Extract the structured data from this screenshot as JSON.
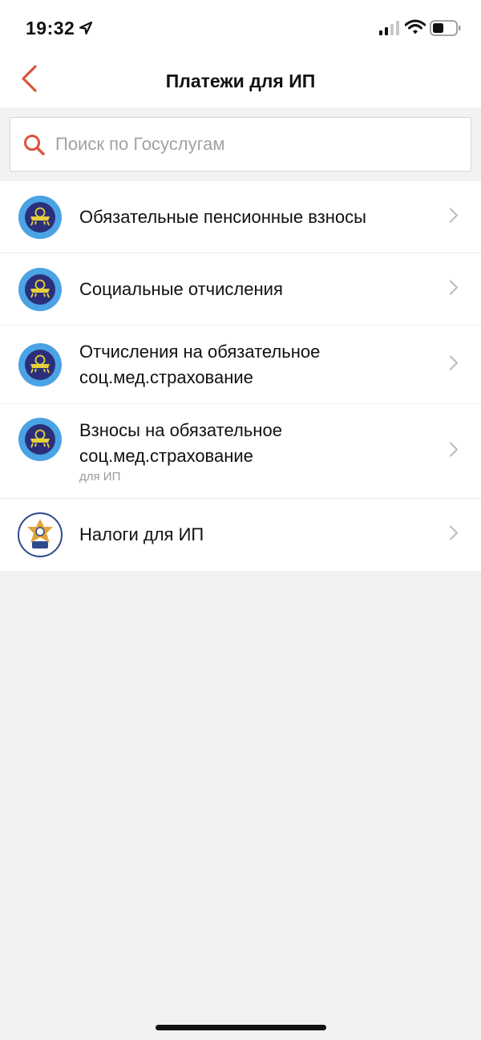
{
  "status_bar": {
    "time": "19:32",
    "icons": [
      "location-arrow-icon",
      "signal-icon",
      "wifi-icon",
      "battery-icon"
    ]
  },
  "nav": {
    "title": "Платежи для ИП",
    "back_icon": "chevron-left-icon"
  },
  "search": {
    "placeholder": "Поиск по Госуслугам",
    "value": ""
  },
  "items": [
    {
      "title_lines": [
        "Обязательные пенсионные взносы"
      ],
      "subtitle": "",
      "icon": "agency-emblem-icon"
    },
    {
      "title_lines": [
        "Социальные отчисления"
      ],
      "subtitle": "",
      "icon": "agency-emblem-icon"
    },
    {
      "title_lines": [
        "Отчисления на обязательное",
        "соц.мед.страхование"
      ],
      "subtitle": "",
      "icon": "agency-emblem-icon"
    },
    {
      "title_lines": [
        "Взносы на обязательное",
        "соц.мед.страхование"
      ],
      "subtitle": "для ИП",
      "icon": "agency-emblem-icon"
    },
    {
      "title_lines": [
        "Налоги для ИП"
      ],
      "subtitle": "",
      "icon": "tax-emblem-icon"
    }
  ],
  "colors": {
    "accent": "#d9553b",
    "background": "#f2f2f2",
    "emblem_outer": "#4aa3e4",
    "emblem_inner": "#2b2f7a",
    "emblem_gold": "#e6d13a",
    "tax_emblem_blue": "#2c4a8c",
    "tax_emblem_gold": "#e3a33a"
  }
}
